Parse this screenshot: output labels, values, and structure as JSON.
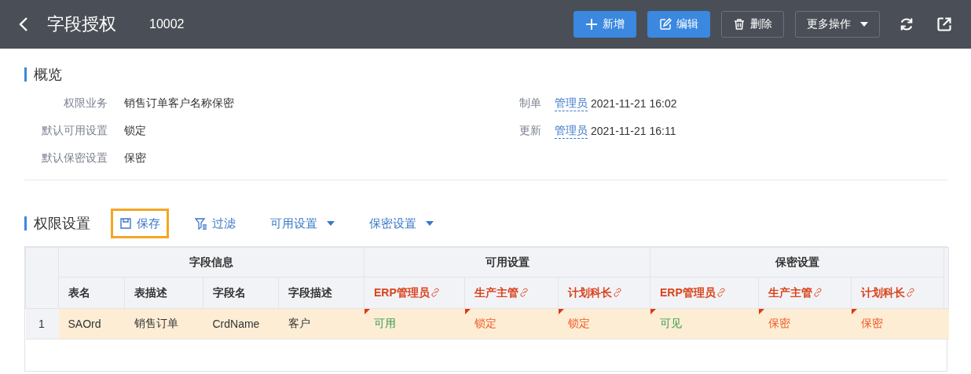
{
  "header": {
    "title": "字段授权",
    "number": "10002",
    "buttons": [
      {
        "label": "新增",
        "kind": "add"
      },
      {
        "label": "编辑",
        "kind": "edit"
      },
      {
        "label": "删除",
        "kind": "delete"
      },
      {
        "label": "更多操作",
        "kind": "more"
      }
    ],
    "icon_buttons": [
      {
        "kind": "refresh"
      },
      {
        "kind": "share"
      }
    ]
  },
  "overview": {
    "title": "概览",
    "left": [
      {
        "label": "权限业务",
        "value": "销售订单客户名称保密"
      },
      {
        "label": "默认可用设置",
        "value": "锁定"
      },
      {
        "label": "默认保密设置",
        "value": "保密"
      }
    ],
    "right": [
      {
        "label": "制单",
        "user": "管理员",
        "time": "2021-11-21 16:02"
      },
      {
        "label": "更新",
        "user": "管理员",
        "time": "2021-11-21 16:11"
      }
    ]
  },
  "permissions": {
    "title": "权限设置",
    "toolbar": [
      {
        "label": "保存",
        "kind": "save",
        "highlighted": true
      },
      {
        "label": "过滤",
        "kind": "filter",
        "highlighted": false
      },
      {
        "label": "可用设置",
        "kind": "dropdown",
        "highlighted": false
      },
      {
        "label": "保密设置",
        "kind": "dropdown",
        "highlighted": false
      }
    ],
    "table": {
      "groups": [
        {
          "label": "字段信息",
          "columns": [
            {
              "label": "表名",
              "linked": false
            },
            {
              "label": "表描述",
              "linked": false
            },
            {
              "label": "字段名",
              "linked": false
            },
            {
              "label": "字段描述",
              "linked": false
            }
          ]
        },
        {
          "label": "可用设置",
          "columns": [
            {
              "label": "ERP管理员",
              "linked": true
            },
            {
              "label": "生产主管",
              "linked": true
            },
            {
              "label": "计划科长",
              "linked": true
            }
          ]
        },
        {
          "label": "保密设置",
          "columns": [
            {
              "label": "ERP管理员",
              "linked": true
            },
            {
              "label": "生产主管",
              "linked": true
            },
            {
              "label": "计划科长",
              "linked": true
            }
          ]
        }
      ],
      "rows": [
        {
          "number": "1",
          "selected": true,
          "cells": [
            {
              "text": "SAOrd",
              "kind": "plain",
              "modified": false
            },
            {
              "text": "销售订单",
              "kind": "plain",
              "modified": false
            },
            {
              "text": "CrdName",
              "kind": "plain",
              "modified": false
            },
            {
              "text": "客户",
              "kind": "plain",
              "modified": false
            },
            {
              "text": "可用",
              "kind": "allowed",
              "modified": true
            },
            {
              "text": "锁定",
              "kind": "restricted",
              "modified": true
            },
            {
              "text": "锁定",
              "kind": "restricted",
              "modified": true
            },
            {
              "text": "可见",
              "kind": "allowed",
              "modified": true
            },
            {
              "text": "保密",
              "kind": "restricted",
              "modified": true
            },
            {
              "text": "保密",
              "kind": "restricted",
              "modified": true
            }
          ]
        }
      ]
    }
  }
}
